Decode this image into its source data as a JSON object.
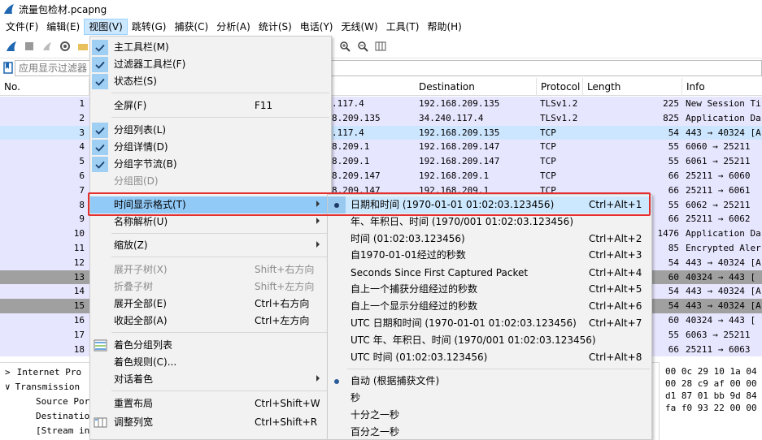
{
  "window": {
    "title": "流量包检材.pcapng"
  },
  "menubar": [
    "文件(F)",
    "编辑(E)",
    "视图(V)",
    "跳转(G)",
    "捕获(C)",
    "分析(A)",
    "统计(S)",
    "电话(Y)",
    "无线(W)",
    "工具(T)",
    "帮助(H)"
  ],
  "filter": {
    "placeholder": "应用显示过滤器"
  },
  "columns": {
    "no": "No.",
    "destination": "Destination",
    "protocol": "Protocol",
    "length": "Length",
    "info": "Info"
  },
  "packets": [
    {
      "no": "1",
      "src": ".117.4",
      "dst": "192.168.209.135",
      "proto": "TLSv1.2",
      "len": "225",
      "info": "New Session Ti"
    },
    {
      "no": "2",
      "src": "8.209.135",
      "dst": "34.240.117.4",
      "proto": "TLSv1.2",
      "len": "825",
      "info": "Application Da"
    },
    {
      "no": "3",
      "src": ".117.4",
      "dst": "192.168.209.135",
      "proto": "TCP",
      "len": "54",
      "info": "443 → 40324 [A"
    },
    {
      "no": "4",
      "src": "8.209.1",
      "dst": "192.168.209.147",
      "proto": "TCP",
      "len": "55",
      "info": "6060 → 25211"
    },
    {
      "no": "5",
      "src": "8.209.1",
      "dst": "192.168.209.147",
      "proto": "TCP",
      "len": "55",
      "info": "6061 → 25211"
    },
    {
      "no": "6",
      "src": "8.209.147",
      "dst": "192.168.209.1",
      "proto": "TCP",
      "len": "66",
      "info": "25211 → 6060"
    },
    {
      "no": "7",
      "src": "8.209.147",
      "dst": "192.168.209.1",
      "proto": "TCP",
      "len": "66",
      "info": "25211 → 6061"
    },
    {
      "no": "8",
      "src": "",
      "dst": "",
      "proto": "",
      "len": "55",
      "info": "6062 → 25211"
    },
    {
      "no": "9",
      "src": "",
      "dst": "",
      "proto": "",
      "len": "66",
      "info": "25211 → 6062"
    },
    {
      "no": "10",
      "src": "",
      "dst": "",
      "proto": "",
      "len": "1476",
      "info": "Application Da"
    },
    {
      "no": "11",
      "src": "",
      "dst": "",
      "proto": "",
      "len": "85",
      "info": "Encrypted Aler"
    },
    {
      "no": "12",
      "src": "",
      "dst": "",
      "proto": "",
      "len": "54",
      "info": "443 → 40324 [A"
    },
    {
      "no": "13",
      "src": "",
      "dst": "",
      "proto": "",
      "len": "60",
      "info": "40324 → 443 ["
    },
    {
      "no": "14",
      "src": "",
      "dst": "",
      "proto": "",
      "len": "54",
      "info": "443 → 40324 [A"
    },
    {
      "no": "15",
      "src": "",
      "dst": "",
      "proto": "",
      "len": "54",
      "info": "443 → 40324 [A"
    },
    {
      "no": "16",
      "src": "",
      "dst": "",
      "proto": "",
      "len": "60",
      "info": "40324 → 443 ["
    },
    {
      "no": "17",
      "src": "",
      "dst": "",
      "proto": "",
      "len": "55",
      "info": "6063 → 25211"
    },
    {
      "no": "18",
      "src": "",
      "dst": "",
      "proto": "",
      "len": "66",
      "info": "25211 → 6063"
    }
  ],
  "details": [
    {
      "arrow": ">",
      "text": "Internet Pro"
    },
    {
      "arrow": "∨",
      "text": "Transmission"
    },
    {
      "arrow": "",
      "text": "Source Por"
    },
    {
      "arrow": "",
      "text": "Destinatio"
    },
    {
      "arrow": "",
      "text": "[Stream in"
    }
  ],
  "hex": [
    "00 0c 29 10 1a 04",
    "00 28 c9 af 00 00",
    "d1 87 01 bb 9d 84",
    "fa f0 93 22 00 00"
  ],
  "view_menu": [
    {
      "label": "主工具栏(M)",
      "checked": true
    },
    {
      "label": "过滤器工具栏(F)",
      "checked": true
    },
    {
      "label": "状态栏(S)",
      "checked": true
    },
    {
      "label": "全屏(F)",
      "shortcut": "F11"
    },
    {
      "label": "分组列表(L)",
      "checked": true
    },
    {
      "label": "分组详情(D)",
      "checked": true
    },
    {
      "label": "分组字节流(B)",
      "checked": true
    },
    {
      "label": "分组图(D)",
      "disabled": true
    },
    {
      "label": "时间显示格式(T)",
      "submenu": true
    },
    {
      "label": "名称解析(U)",
      "submenu": true
    },
    {
      "label": "缩放(Z)",
      "submenu": true
    },
    {
      "label": "展开子树(X)",
      "shortcut": "Shift+右方向",
      "disabled": true
    },
    {
      "label": "折叠子树",
      "shortcut": "Shift+左方向",
      "disabled": true
    },
    {
      "label": "展开全部(E)",
      "shortcut": "Ctrl+右方向"
    },
    {
      "label": "收起全部(A)",
      "shortcut": "Ctrl+左方向"
    },
    {
      "label": "着色分组列表"
    },
    {
      "label": "着色规则(C)..."
    },
    {
      "label": "对话着色",
      "submenu": true
    },
    {
      "label": "重置布局",
      "shortcut": "Ctrl+Shift+W"
    },
    {
      "label": "调整列宽",
      "shortcut": "Ctrl+Shift+R"
    }
  ],
  "time_submenu": [
    {
      "label": "日期和时间 (1970-01-01 01:02:03.123456)",
      "shortcut": "Ctrl+Alt+1",
      "selected": true
    },
    {
      "label": "年、年积日、时间 (1970/001 01:02:03.123456)",
      "shortcut": ""
    },
    {
      "label": "时间 (01:02:03.123456)",
      "shortcut": "Ctrl+Alt+2"
    },
    {
      "label": "自1970-01-01经过的秒数",
      "shortcut": "Ctrl+Alt+3"
    },
    {
      "label": "Seconds Since First Captured Packet",
      "shortcut": "Ctrl+Alt+4"
    },
    {
      "label": "自上一个捕获分组经过的秒数",
      "shortcut": "Ctrl+Alt+5"
    },
    {
      "label": "自上一个显示分组经过的秒数",
      "shortcut": "Ctrl+Alt+6"
    },
    {
      "label": "UTC 日期和时间 (1970-01-01 01:02:03.123456)",
      "shortcut": "Ctrl+Alt+7"
    },
    {
      "label": "UTC 年、年积日、时间 (1970/001 01:02:03.123456)",
      "shortcut": ""
    },
    {
      "label": "UTC 时间 (01:02:03.123456)",
      "shortcut": "Ctrl+Alt+8"
    },
    {
      "label": "自动 (根据捕获文件)",
      "shortcut": "",
      "selected": true
    },
    {
      "label": "秒",
      "shortcut": ""
    },
    {
      "label": "十分之一秒",
      "shortcut": ""
    },
    {
      "label": "百分之一秒",
      "shortcut": ""
    }
  ],
  "colors": {
    "accent": "#91c9f7",
    "highlight_box": "#e53030",
    "row_tint": "#e7e6ff",
    "row_selected": "#cde6ff",
    "row_dark": "#a0a0a0"
  }
}
